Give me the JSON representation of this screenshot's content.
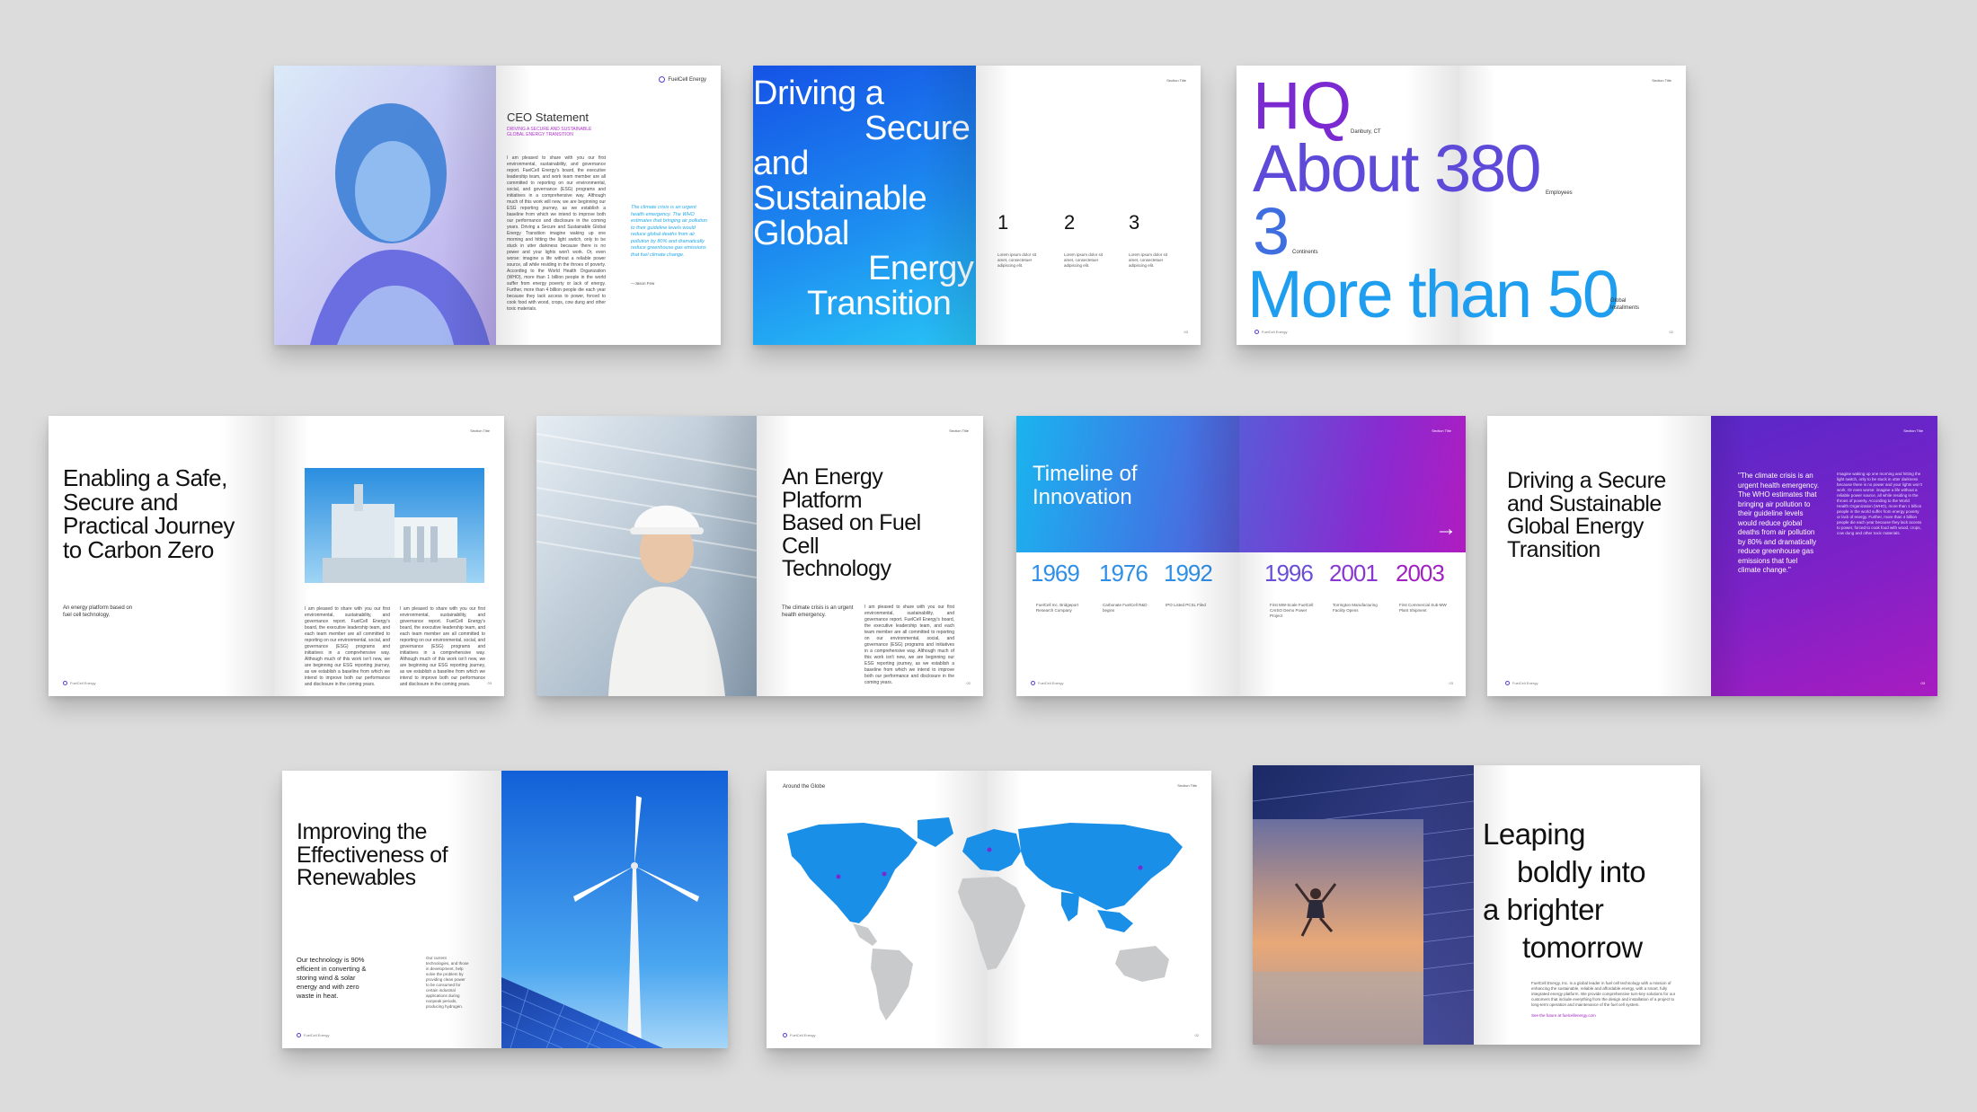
{
  "colors": {
    "background": "#dcdcdc",
    "brand_blue": "#1e66e0",
    "brand_cyan": "#20b6f0",
    "brand_purple": "#7a2ad0",
    "brand_magenta": "#a020c0"
  },
  "s1": {
    "logo": "FuelCell Energy",
    "title": "CEO Statement",
    "subtitle": "DRIVING A SECURE AND SUSTAINABLE GLOBAL ENERGY TRANSITION",
    "body": "I am pleased to share with you our first environmental, sustainability, and governance report. FuelCell Energy's board, the executive leadership team, and work team member are all committed to reporting on our environmental, social, and governance (ESG) programs and initiatives in a comprehensive way. Although much of this work will new, we are beginning our ESG reporting journey, as we establish a baseline from which we intend to improve both our performance and disclosure in the coming years. Driving a Secure and Sustainable Global Energy Transition imagine waking up one morning and hitting the light switch, only to be stuck in utter darkness because there is no power and your lights won't work. Or, even worse: imagine a life without a reliable power source, all while residing in the throes of poverty. According to the World Health Organization (WHO), more than 1 billion people in the world suffer from energy poverty or lack of energy. Further, more than 4 billion people die each year because they lack access to power, forced to cook food with wood, crops, cow dung and other toxic materials.",
    "quote": "The climate crisis is an urgent health emergency. The WHO estimates that bringing air pollution to their guideline levels would reduce global deaths from air pollution by 80% and dramatically reduce greenhouse gas emissions that fuel climate change.",
    "quote_author": "—Jason Few"
  },
  "s2": {
    "heading_lines": [
      "Driving a",
      "Secure",
      "and",
      "Sustainable",
      "Global",
      "Energy",
      "Transition"
    ],
    "section_title": "Section Title",
    "numbers": [
      "1",
      "2",
      "3"
    ],
    "number_caption": "Lorem ipsum dolor sit amet, consectetuer adipiscing elit.",
    "page_num": "03"
  },
  "s3": {
    "section_title": "Section Title",
    "stats": [
      {
        "value": "HQ",
        "label": "Danbury, CT"
      },
      {
        "value": "About 380",
        "label": "Employees"
      },
      {
        "value": "3",
        "label": "Continents"
      },
      {
        "value": "More than 50",
        "label": "Global Installments"
      }
    ],
    "footer": "FuelCell Energy",
    "page_num": "02"
  },
  "s4": {
    "heading": "Enabling a Safe, Secure and Practical Journey to Carbon Zero",
    "sub": "An energy platform based on fuel cell technology.",
    "section_title": "Section Title",
    "body": "I am pleased to share with you our first environmental, sustainability, and governance report. FuelCell Energy's board, the executive leadership team, and each team member are all committed to reporting on our environmental, social, and governance (ESG) programs and initiatives in a comprehensive way. Although much of this work isn't new, we are beginning our ESG reporting journey, as we establish a baseline from which we intend to improve both our performance and disclosure in the coming years.",
    "footer": "FuelCell Energy",
    "page_num": "03"
  },
  "s5": {
    "heading": "An Energy Platform Based on Fuel Cell Technology",
    "sub": "The climate crisis is an urgent health emergency.",
    "section_title": "Section Title",
    "body": "I am pleased to share with you our first environmental, sustainability, and governance report. FuelCell Energy's board, the executive leadership team, and each team member are all committed to reporting on our environmental, social, and governance (ESG) programs and initiatives in a comprehensive way. Although much of this work isn't new, we are beginning our ESG reporting journey, as we establish a baseline from which we intend to improve both our performance and disclosure in the coming years.",
    "page_num": "02"
  },
  "s6": {
    "heading": "Timeline of Innovation",
    "section_title": "Section Title",
    "years_left": [
      "1969",
      "1976",
      "1992"
    ],
    "years_right": [
      "1996",
      "2001",
      "2003"
    ],
    "captions_left": [
      "FuelCell Inc. Bridgeport Research Company",
      "Carbonate FuelCell R&D begins",
      "IPO Listed PCSL Filed"
    ],
    "captions_right": [
      "First MW-Scale FuelCell CAISO Demo Power Project",
      "Torrington Manufacturing Facility Opens",
      "First Commercial Sub-MW Plant Shipment"
    ],
    "footer": "FuelCell Energy",
    "page_num": "03"
  },
  "s7": {
    "heading": "Driving a Secure and Sustainable Global Energy Transition",
    "section_title": "Section Title",
    "quote": "\"The climate crisis is an urgent health emergency. The WHO estimates that bringing air pollution to their guideline levels would reduce global deaths from air pollution by 80% and dramatically reduce greenhouse gas emissions that fuel climate change.\"",
    "body": "Imagine waking up one morning and hitting the light switch, only to be stuck in utter darkness because there is no power and your lights won't work. Or even worse: imagine a life without a reliable power source, all while residing in the throes of poverty. According to the World Health Organization (WHO), more than 1 billion people in the world suffer from energy poverty or lack of energy. Further, more than 4 billion people die each year because they lack access to power, forced to cook food with wood, crops, cow dung and other toxic materials.",
    "footer": "FuelCell Energy",
    "page_num": "03"
  },
  "s8": {
    "heading": "Improving the Effectiveness of Renewables",
    "sub": "Our technology is 90% efficient in converting & storing wind & solar energy and with zero waste in heat.",
    "side": "Our current technologies, and those in development, help solve the problem by providing clean power to be consumed for certain industrial applications during nonpeak periods, producing hydrogen.",
    "footer": "FuelCell Energy",
    "page_num": "03"
  },
  "s9": {
    "title": "Around the Globe",
    "section_title": "Section Title",
    "footer": "FuelCell Energy",
    "page_num": "02"
  },
  "s10": {
    "heading_lines": [
      "Leaping",
      "boldly into",
      "a brighter",
      "tomorrow"
    ],
    "body": "FuelCell Energy, Inc. is a global leader in fuel cell technology with a mission of enhancing the sustainable, reliable and affordable energy, with a smart, fully integrated energy platform. We provide comprehensive turn-key solutions for our customers that include everything from the design and installation of a project to long-term operation and maintenance of the fuel cell system.",
    "link": "See the future at fuelcellenergy.com"
  }
}
